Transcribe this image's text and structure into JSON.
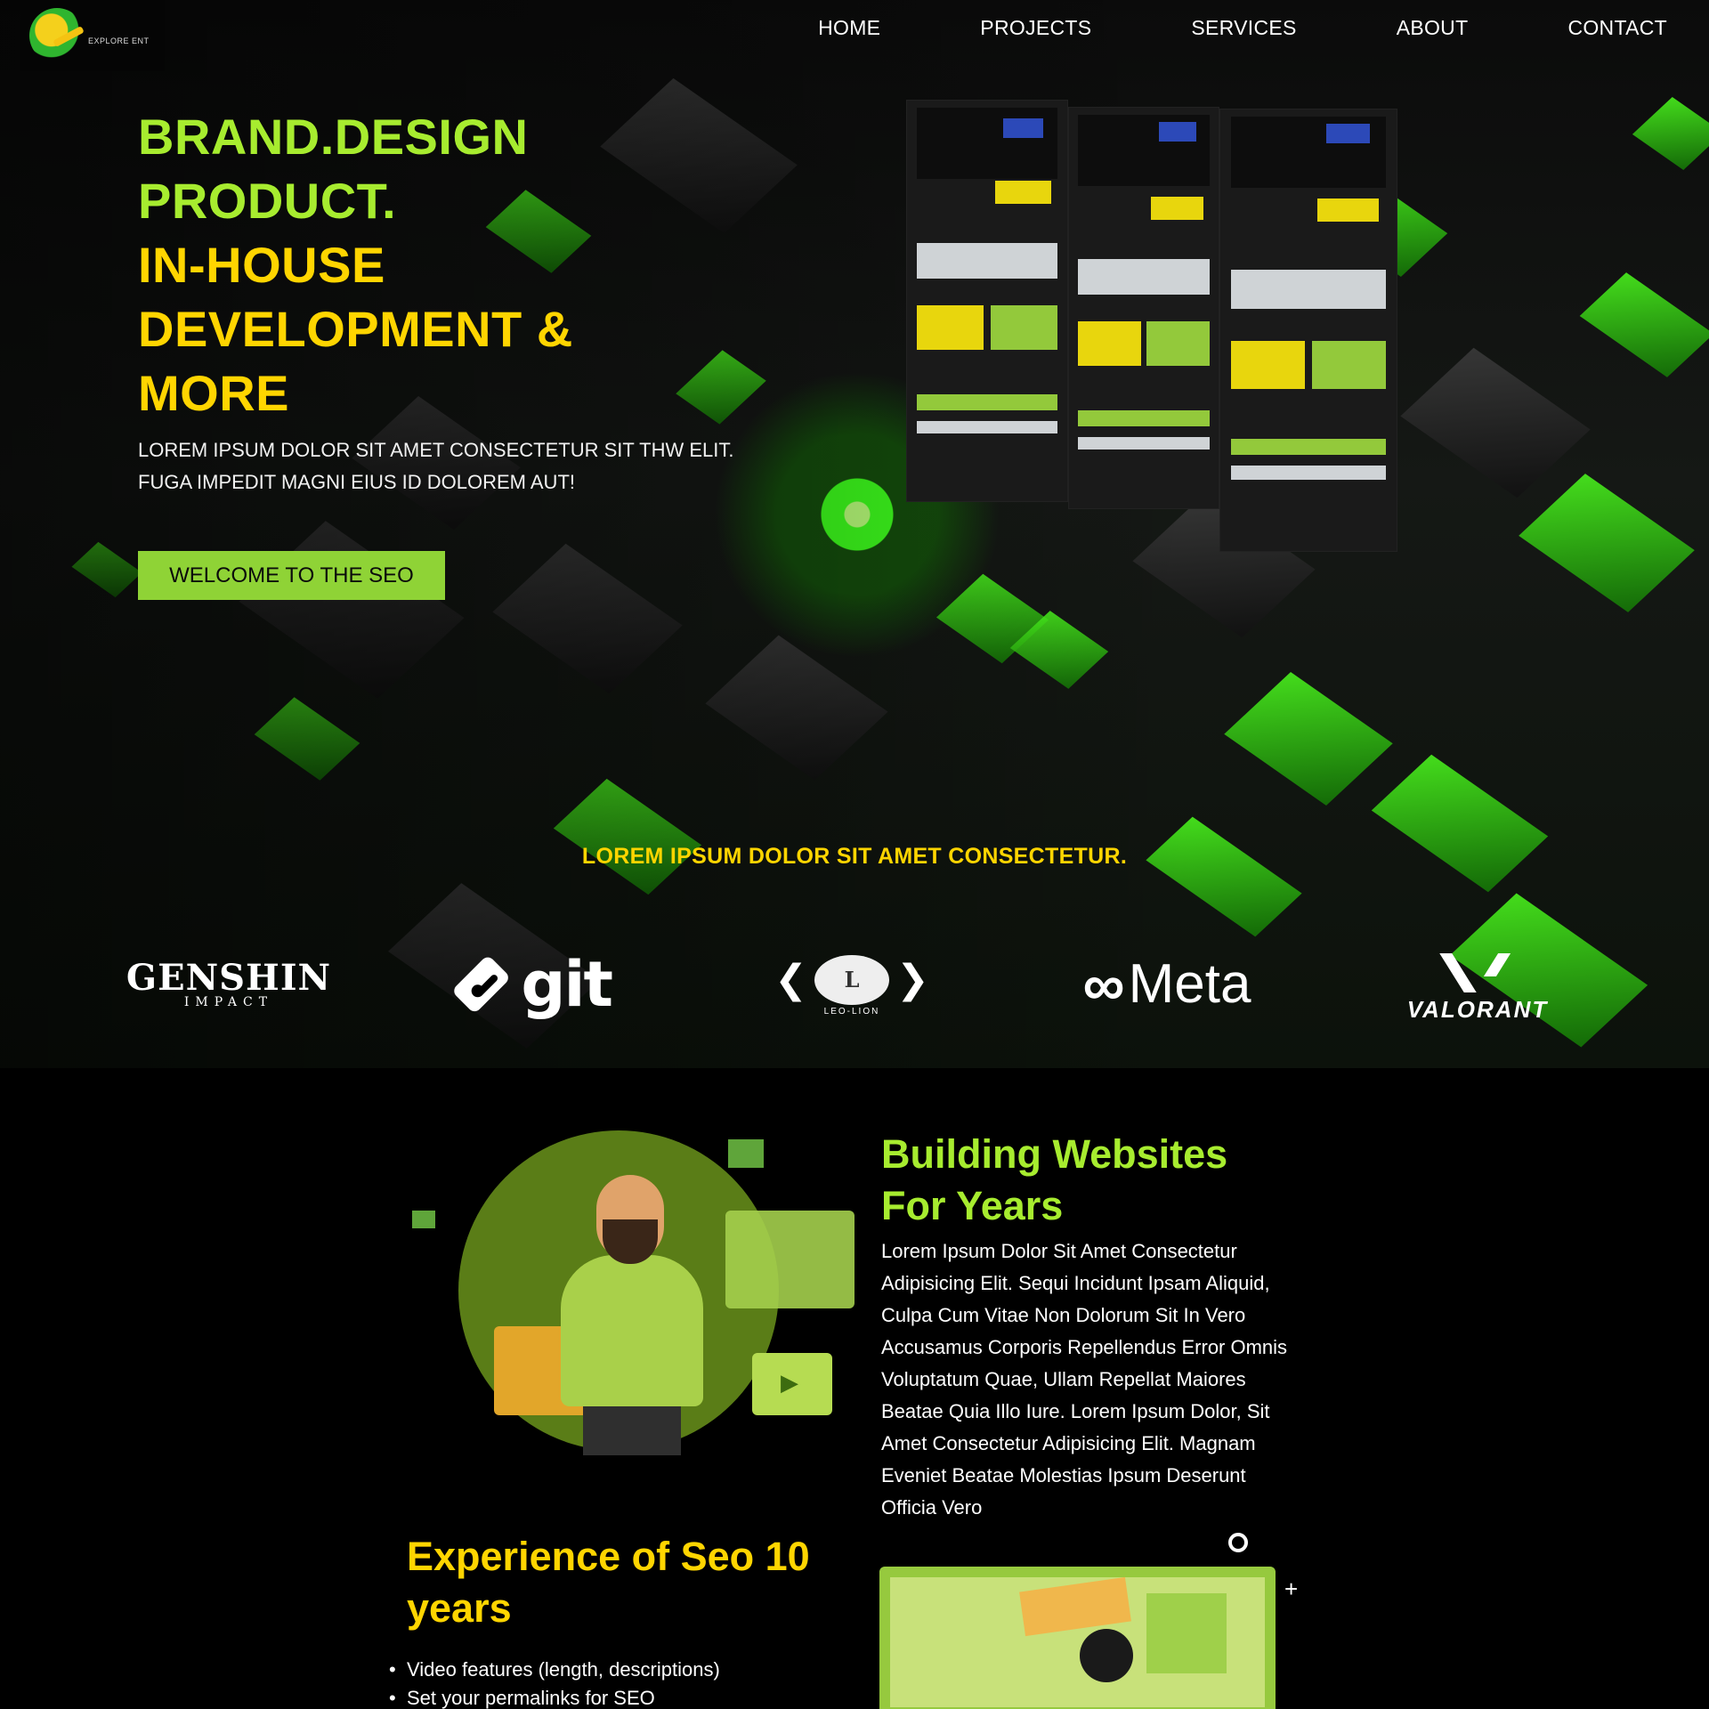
{
  "brand": {
    "logo_text": "EXPLORE ENT"
  },
  "nav": {
    "items": [
      "HOME",
      "PROJECTS",
      "SERVICES",
      "ABOUT",
      "CONTACT"
    ]
  },
  "hero": {
    "headline": [
      "BRAND.DESIGN",
      "PRODUCT.",
      "IN-HOUSE",
      "DEVELOPMENT &",
      "MORE"
    ],
    "subtext": [
      "LOREM IPSUM DOLOR SIT AMET CONSECTETUR SIT THW ELIT.",
      "FUGA IMPEDIT MAGNI EIUS ID DOLOREM AUT!"
    ],
    "cta_label": "WELCOME TO THE SEO",
    "tagline": "LOREM IPSUM DOLOR SIT AMET CONSECTETUR."
  },
  "partners": {
    "genshin": {
      "big": "GENSHIN",
      "small": "IMPACT"
    },
    "git": {
      "word": "git"
    },
    "leo": {
      "letter": "L",
      "caption": "LEO-LION"
    },
    "meta": {
      "symbol": "∞",
      "word": "Meta"
    },
    "valorant": {
      "word": "VALORANT"
    }
  },
  "about": {
    "title": [
      "Building Websites",
      "For Years"
    ],
    "body": "Lorem Ipsum Dolor Sit Amet Consectetur Adipisicing Elit. Sequi Incidunt Ipsam Aliquid, Culpa Cum Vitae Non Dolorum Sit In Vero Accusamus Corporis Repellendus Error Omnis Voluptatum Quae, Ullam Repellat Maiores Beatae Quia Illo Iure. Lorem Ipsum Dolor, Sit Amet Consectetur Adipisicing Elit. Magnam Eveniet Beatae Molestias Ipsum Deserunt Officia Vero",
    "experience_title": "Experience of Seo 10 years",
    "experience_list": [
      "Video features (length, descriptions)",
      "Set your permalinks for SEO"
    ]
  },
  "colors": {
    "accent_green": "#a7ec2f",
    "accent_yellow": "#ffd500",
    "cta_bg": "#8fd336",
    "background": "#000000"
  }
}
